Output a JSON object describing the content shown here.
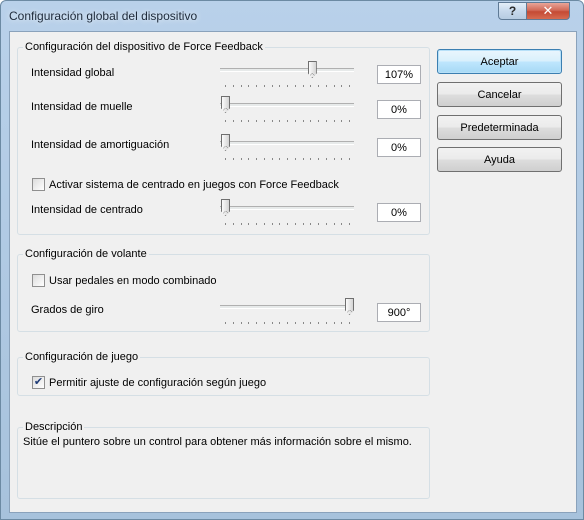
{
  "window": {
    "title": "Configuración global del dispositivo",
    "help_glyph": "?",
    "close_glyph": "✕"
  },
  "force_feedback": {
    "title": "Configuración del dispositivo de Force Feedback",
    "global_intensity": {
      "label": "Intensidad global",
      "value": "107%",
      "level": 0.7
    },
    "spring_intensity": {
      "label": "Intensidad de muelle",
      "value": "0%",
      "level": 0.0
    },
    "damping_intensity": {
      "label": "Intensidad de amortiguación",
      "value": "0%",
      "level": 0.0
    },
    "centering_checkbox": {
      "label": "Activar sistema de centrado en juegos con Force Feedback",
      "checked": false
    },
    "centering_intensity": {
      "label": "Intensidad de centrado",
      "value": "0%",
      "level": 0.0
    }
  },
  "wheel": {
    "title": "Configuración de volante",
    "combined_pedals": {
      "label": "Usar pedales en modo combinado",
      "checked": false
    },
    "rotation": {
      "label": "Grados de giro",
      "value": "900°",
      "level": 1.0
    }
  },
  "game": {
    "title": "Configuración de juego",
    "allow_adjust": {
      "label": "Permitir ajuste de configuración según juego",
      "checked": true
    }
  },
  "description": {
    "title": "Descripción",
    "text": "Sitúe el puntero sobre un control para obtener más información sobre el mismo."
  },
  "buttons": {
    "accept": "Aceptar",
    "cancel": "Cancelar",
    "defaults": "Predeterminada",
    "help": "Ayuda"
  },
  "check_glyph": "✔"
}
